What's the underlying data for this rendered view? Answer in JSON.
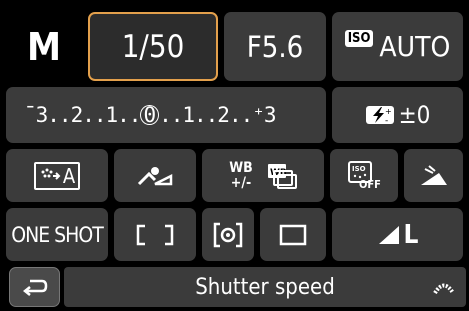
{
  "mode": "M",
  "shutter": "1/50",
  "aperture": "F5.6",
  "iso": {
    "badge": "ISO",
    "value": "AUTO"
  },
  "exposure_scale": {
    "left": "¯3..2..1..",
    "zero": "0",
    "right": "..1..2..⁺3"
  },
  "flash_comp": {
    "value": "±0"
  },
  "wb_adjust": {
    "top": "WB",
    "bottom": "+/-"
  },
  "picture_style": {
    "label": "A"
  },
  "high_iso": {
    "suffix": "OFF"
  },
  "af_operation": "ONE SHOT",
  "quality_size": "L",
  "status": {
    "label": "Shutter speed"
  },
  "colors": {
    "tile": "#3b3b3b",
    "selected_border": "#e3a04c",
    "bg": "#000000",
    "text": "#ffffff"
  }
}
